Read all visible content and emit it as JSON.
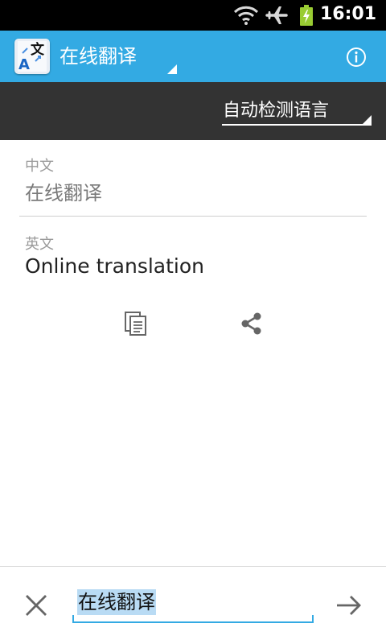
{
  "status_bar": {
    "time": "16:01",
    "icons": [
      "wifi-icon",
      "airplane-mode-icon",
      "battery-charging-icon"
    ]
  },
  "action_bar": {
    "app_icon": "translate-app-icon",
    "app_icon_glyphs": [
      "文",
      "A"
    ],
    "title": "在线翻译",
    "info_icon": "info-icon",
    "accent_color": "#33aae3"
  },
  "language_bar": {
    "selected": "自动检测语言",
    "background_color": "#333333"
  },
  "source": {
    "label": "中文",
    "text": "在线翻译"
  },
  "result": {
    "label": "英文",
    "text": "Online translation",
    "actions": [
      "copy-icon",
      "share-icon"
    ]
  },
  "input_bar": {
    "value": "在线翻译",
    "clear_icon": "close-icon",
    "submit_icon": "arrow-right-icon"
  }
}
